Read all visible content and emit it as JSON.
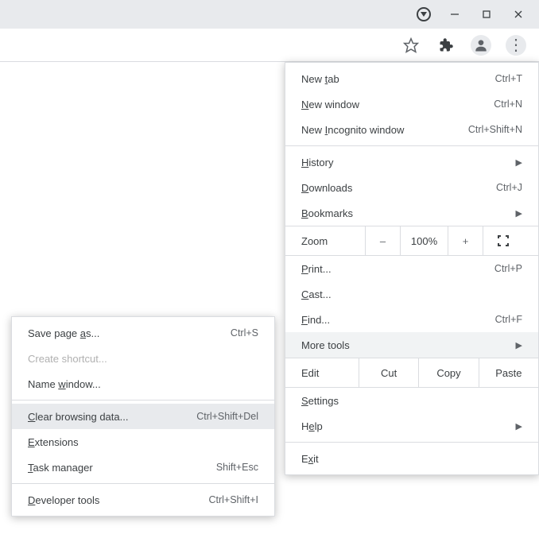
{
  "window": {
    "minimize": "–",
    "maximize": "□",
    "close": "✕"
  },
  "menu": {
    "newTab": "New tab",
    "newTabU": "t",
    "newTabSc": "Ctrl+T",
    "newWindow": "New window",
    "newWindowU": "N",
    "newWindowSc": "Ctrl+N",
    "incognito": "New Incognito window",
    "incognitoU": "I",
    "incognitoSc": "Ctrl+Shift+N",
    "history": "History",
    "historyU": "H",
    "downloads": "Downloads",
    "downloadsU": "D",
    "downloadsSc": "Ctrl+J",
    "bookmarks": "Bookmarks",
    "bookmarksU": "B",
    "zoomLabel": "Zoom",
    "zoomMinus": "–",
    "zoomVal": "100%",
    "zoomPlus": "+",
    "print": "Print...",
    "printU": "P",
    "printSc": "Ctrl+P",
    "cast": "Cast...",
    "castU": "C",
    "find": "Find...",
    "findU": "F",
    "findSc": "Ctrl+F",
    "moreTools": "More tools",
    "editLabel": "Edit",
    "cut": "Cut",
    "copy": "Copy",
    "paste": "Paste",
    "settings": "Settings",
    "settingsU": "S",
    "help": "Help",
    "helpU": "e",
    "exit": "Exit",
    "exitU": "x"
  },
  "sub": {
    "saveAs": "Save page as...",
    "saveAsU": "a",
    "saveAsSc": "Ctrl+S",
    "shortcut": "Create shortcut...",
    "nameWin": "Name window...",
    "nameWinU": "w",
    "clearData": "Clear browsing data...",
    "clearDataU": "C",
    "clearDataSc": "Ctrl+Shift+Del",
    "ext": "Extensions",
    "extU": "E",
    "taskMgr": "Task manager",
    "taskMgrU": "T",
    "taskMgrSc": "Shift+Esc",
    "devTools": "Developer tools",
    "devToolsU": "D",
    "devToolsSc": "Ctrl+Shift+I"
  }
}
